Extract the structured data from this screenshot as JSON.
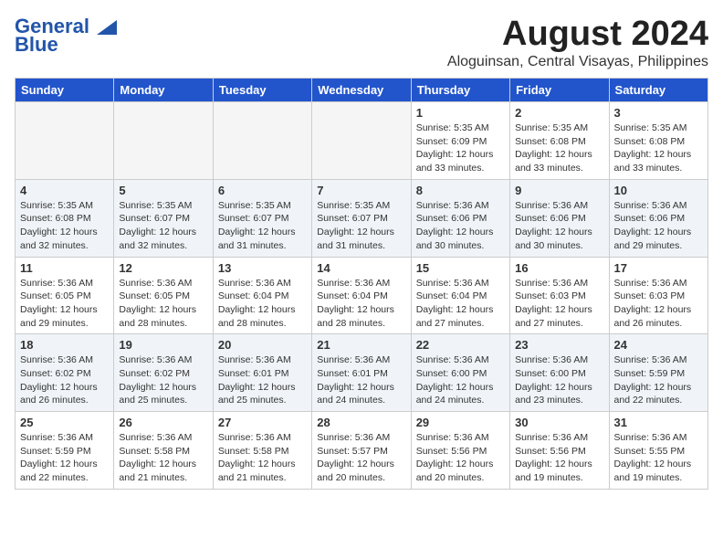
{
  "header": {
    "logo_line1": "General",
    "logo_line2": "Blue",
    "month_year": "August 2024",
    "location": "Aloguinsan, Central Visayas, Philippines"
  },
  "weekdays": [
    "Sunday",
    "Monday",
    "Tuesday",
    "Wednesday",
    "Thursday",
    "Friday",
    "Saturday"
  ],
  "weeks": [
    [
      {
        "day": "",
        "empty": true
      },
      {
        "day": "",
        "empty": true
      },
      {
        "day": "",
        "empty": true
      },
      {
        "day": "",
        "empty": true
      },
      {
        "day": "1",
        "sunrise": "5:35 AM",
        "sunset": "6:09 PM",
        "daylight": "12 hours and 33 minutes."
      },
      {
        "day": "2",
        "sunrise": "5:35 AM",
        "sunset": "6:08 PM",
        "daylight": "12 hours and 33 minutes."
      },
      {
        "day": "3",
        "sunrise": "5:35 AM",
        "sunset": "6:08 PM",
        "daylight": "12 hours and 33 minutes."
      }
    ],
    [
      {
        "day": "4",
        "sunrise": "5:35 AM",
        "sunset": "6:08 PM",
        "daylight": "12 hours and 32 minutes."
      },
      {
        "day": "5",
        "sunrise": "5:35 AM",
        "sunset": "6:07 PM",
        "daylight": "12 hours and 32 minutes."
      },
      {
        "day": "6",
        "sunrise": "5:35 AM",
        "sunset": "6:07 PM",
        "daylight": "12 hours and 31 minutes."
      },
      {
        "day": "7",
        "sunrise": "5:35 AM",
        "sunset": "6:07 PM",
        "daylight": "12 hours and 31 minutes."
      },
      {
        "day": "8",
        "sunrise": "5:36 AM",
        "sunset": "6:06 PM",
        "daylight": "12 hours and 30 minutes."
      },
      {
        "day": "9",
        "sunrise": "5:36 AM",
        "sunset": "6:06 PM",
        "daylight": "12 hours and 30 minutes."
      },
      {
        "day": "10",
        "sunrise": "5:36 AM",
        "sunset": "6:06 PM",
        "daylight": "12 hours and 29 minutes."
      }
    ],
    [
      {
        "day": "11",
        "sunrise": "5:36 AM",
        "sunset": "6:05 PM",
        "daylight": "12 hours and 29 minutes."
      },
      {
        "day": "12",
        "sunrise": "5:36 AM",
        "sunset": "6:05 PM",
        "daylight": "12 hours and 28 minutes."
      },
      {
        "day": "13",
        "sunrise": "5:36 AM",
        "sunset": "6:04 PM",
        "daylight": "12 hours and 28 minutes."
      },
      {
        "day": "14",
        "sunrise": "5:36 AM",
        "sunset": "6:04 PM",
        "daylight": "12 hours and 28 minutes."
      },
      {
        "day": "15",
        "sunrise": "5:36 AM",
        "sunset": "6:04 PM",
        "daylight": "12 hours and 27 minutes."
      },
      {
        "day": "16",
        "sunrise": "5:36 AM",
        "sunset": "6:03 PM",
        "daylight": "12 hours and 27 minutes."
      },
      {
        "day": "17",
        "sunrise": "5:36 AM",
        "sunset": "6:03 PM",
        "daylight": "12 hours and 26 minutes."
      }
    ],
    [
      {
        "day": "18",
        "sunrise": "5:36 AM",
        "sunset": "6:02 PM",
        "daylight": "12 hours and 26 minutes."
      },
      {
        "day": "19",
        "sunrise": "5:36 AM",
        "sunset": "6:02 PM",
        "daylight": "12 hours and 25 minutes."
      },
      {
        "day": "20",
        "sunrise": "5:36 AM",
        "sunset": "6:01 PM",
        "daylight": "12 hours and 25 minutes."
      },
      {
        "day": "21",
        "sunrise": "5:36 AM",
        "sunset": "6:01 PM",
        "daylight": "12 hours and 24 minutes."
      },
      {
        "day": "22",
        "sunrise": "5:36 AM",
        "sunset": "6:00 PM",
        "daylight": "12 hours and 24 minutes."
      },
      {
        "day": "23",
        "sunrise": "5:36 AM",
        "sunset": "6:00 PM",
        "daylight": "12 hours and 23 minutes."
      },
      {
        "day": "24",
        "sunrise": "5:36 AM",
        "sunset": "5:59 PM",
        "daylight": "12 hours and 22 minutes."
      }
    ],
    [
      {
        "day": "25",
        "sunrise": "5:36 AM",
        "sunset": "5:59 PM",
        "daylight": "12 hours and 22 minutes."
      },
      {
        "day": "26",
        "sunrise": "5:36 AM",
        "sunset": "5:58 PM",
        "daylight": "12 hours and 21 minutes."
      },
      {
        "day": "27",
        "sunrise": "5:36 AM",
        "sunset": "5:58 PM",
        "daylight": "12 hours and 21 minutes."
      },
      {
        "day": "28",
        "sunrise": "5:36 AM",
        "sunset": "5:57 PM",
        "daylight": "12 hours and 20 minutes."
      },
      {
        "day": "29",
        "sunrise": "5:36 AM",
        "sunset": "5:56 PM",
        "daylight": "12 hours and 20 minutes."
      },
      {
        "day": "30",
        "sunrise": "5:36 AM",
        "sunset": "5:56 PM",
        "daylight": "12 hours and 19 minutes."
      },
      {
        "day": "31",
        "sunrise": "5:36 AM",
        "sunset": "5:55 PM",
        "daylight": "12 hours and 19 minutes."
      }
    ]
  ]
}
